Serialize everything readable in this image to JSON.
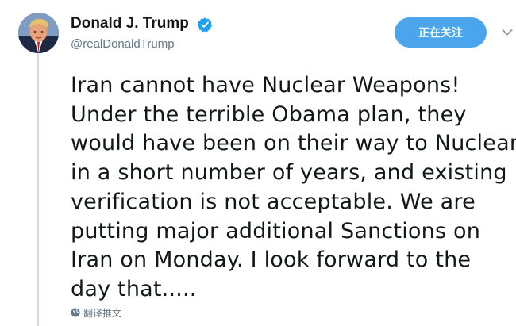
{
  "author": {
    "display_name": "Donald J. Trump",
    "handle": "@realDonaldTrump",
    "verified": true,
    "avatar_icon": "profile-photo"
  },
  "follow_button": {
    "label": "正在关注"
  },
  "menu": {
    "icon": "chevron-down-icon"
  },
  "tweet": {
    "lines": [
      "Iran cannot have Nuclear Weapons!",
      "Under the terrible Obama plan, they",
      "would have been on their way to Nuclear",
      "in a short number of years, and existing",
      "verification is not acceptable. We are",
      "putting major additional Sanctions on",
      "Iran on Monday. I look forward to the",
      "day that....."
    ]
  },
  "translate": {
    "label": "翻译推文",
    "icon": "globe-icon"
  },
  "colors": {
    "accent": "#4aa5ec",
    "verified": "#1da1f2",
    "text": "#14171a",
    "secondary": "#657786",
    "thread_line": "#cfd9de"
  }
}
